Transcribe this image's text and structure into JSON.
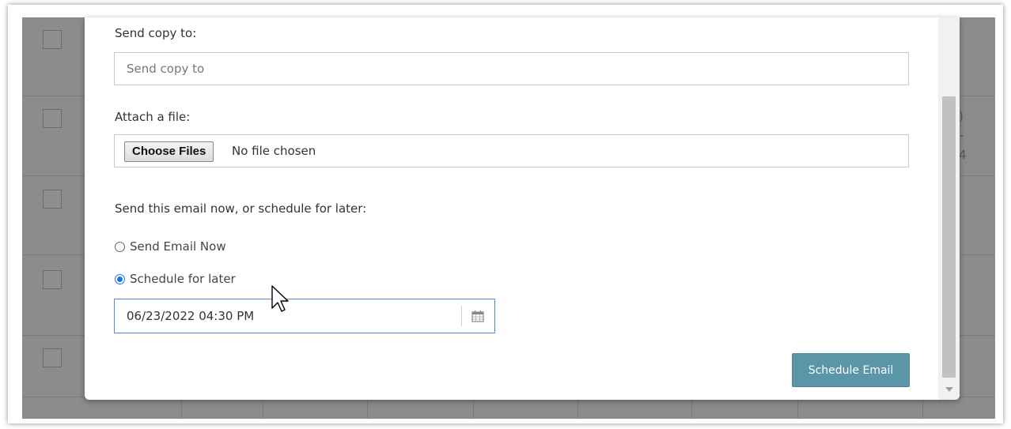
{
  "copy_section": {
    "label": "Send copy to:",
    "placeholder": "Send copy to",
    "value": ""
  },
  "attach_section": {
    "label": "Attach a file:",
    "button_label": "Choose Files",
    "status_text": "No file chosen"
  },
  "schedule_section": {
    "prompt": "Send this email now, or schedule for later:",
    "options": [
      {
        "label": "Send Email Now",
        "selected": false
      },
      {
        "label": "Schedule for later",
        "selected": true
      }
    ],
    "datetime_value": "06/23/2022 04:30 PM"
  },
  "submit_label": "Schedule Email",
  "background_fragments": [
    ")",
    "-",
    "4"
  ],
  "icons": {
    "calendar": "calendar-icon",
    "cursor": "mouse-pointer-icon"
  },
  "colors": {
    "primary_button": "#5a95a8",
    "focus_border": "#4a90d9",
    "radio_selected": "#1a73e8",
    "overlay": "#8c8c8c"
  }
}
